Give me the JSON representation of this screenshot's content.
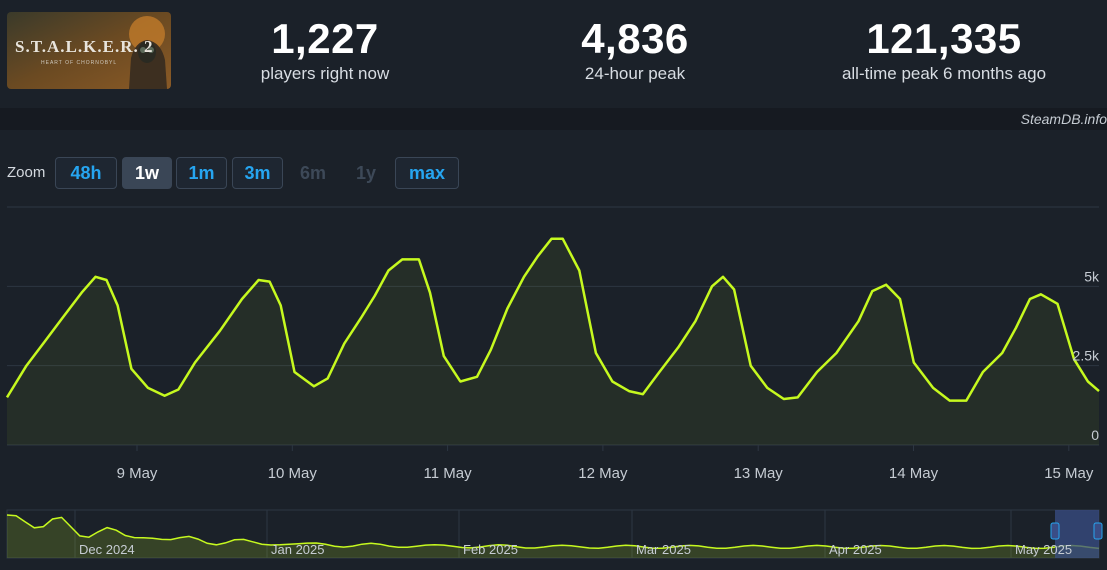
{
  "game": {
    "logo_text": "S.T.A.L.K.E.R. 2",
    "logo_subtext": "HEART OF CHORNOBYL"
  },
  "stats": [
    {
      "value": "1,227",
      "label": "players right now"
    },
    {
      "value": "4,836",
      "label": "24-hour peak"
    },
    {
      "value": "121,335",
      "label": "all-time peak 6 months ago"
    }
  ],
  "credit": "SteamDB.info",
  "zoom": {
    "label": "Zoom",
    "buttons": [
      {
        "label": "48h",
        "state": "normal"
      },
      {
        "label": "1w",
        "state": "active"
      },
      {
        "label": "1m",
        "state": "normal"
      },
      {
        "label": "3m",
        "state": "normal"
      },
      {
        "label": "6m",
        "state": "disabled"
      },
      {
        "label": "1y",
        "state": "disabled"
      },
      {
        "label": "max",
        "state": "normal"
      }
    ]
  },
  "colors": {
    "line": "#c6f91f",
    "grid": "#2d3642",
    "axis_text": "#c6ccd3",
    "nav_selection": "#3a4d86"
  },
  "chart_data": {
    "type": "line",
    "title": "",
    "xlabel": "",
    "ylabel": "",
    "xlim": [
      "May 8, 07:00",
      "May 15, 06:00"
    ],
    "ylim": [
      0,
      7500
    ],
    "y_ticks": [
      0,
      2500,
      5000
    ],
    "y_tick_labels": [
      "0",
      "2.5k",
      "5k"
    ],
    "x_ticks": [
      {
        "x": 1,
        "label": "9 May"
      },
      {
        "x": 2,
        "label": "10 May"
      },
      {
        "x": 3,
        "label": "11 May"
      },
      {
        "x": 4,
        "label": "12 May"
      },
      {
        "x": 5,
        "label": "13 May"
      },
      {
        "x": 6,
        "label": "14 May"
      },
      {
        "x": 7,
        "label": "15 May"
      }
    ],
    "grid": true,
    "legend": "none",
    "series": [
      {
        "name": "",
        "x_unit": "days since 8 May 00:00",
        "points": [
          [
            0.3,
            1500
          ],
          [
            0.37,
            2500
          ],
          [
            0.44,
            3300
          ],
          [
            0.5,
            4000
          ],
          [
            0.57,
            4800
          ],
          [
            0.62,
            5300
          ],
          [
            0.66,
            5200
          ],
          [
            0.7,
            4400
          ],
          [
            0.75,
            2400
          ],
          [
            0.81,
            1800
          ],
          [
            0.87,
            1550
          ],
          [
            0.92,
            1750
          ],
          [
            0.98,
            2600
          ],
          [
            1.07,
            3600
          ],
          [
            1.15,
            4600
          ],
          [
            1.21,
            5200
          ],
          [
            1.25,
            5150
          ],
          [
            1.29,
            4400
          ],
          [
            1.34,
            2300
          ],
          [
            1.41,
            1850
          ],
          [
            1.46,
            2100
          ],
          [
            1.52,
            3200
          ],
          [
            1.58,
            4000
          ],
          [
            1.63,
            4700
          ],
          [
            1.68,
            5500
          ],
          [
            1.73,
            5850
          ],
          [
            1.79,
            5850
          ],
          [
            1.83,
            4800
          ],
          [
            1.88,
            2800
          ],
          [
            1.94,
            2000
          ],
          [
            2.0,
            2150
          ],
          [
            2.05,
            3000
          ],
          [
            2.11,
            4300
          ],
          [
            2.17,
            5300
          ],
          [
            2.22,
            5950
          ],
          [
            2.27,
            6500
          ],
          [
            2.31,
            6500
          ],
          [
            2.37,
            5500
          ],
          [
            2.43,
            2900
          ],
          [
            2.49,
            2000
          ],
          [
            2.55,
            1700
          ],
          [
            2.6,
            1600
          ],
          [
            2.66,
            2300
          ],
          [
            2.73,
            3100
          ],
          [
            2.79,
            3900
          ],
          [
            2.85,
            5000
          ],
          [
            2.89,
            5300
          ],
          [
            2.93,
            4900
          ],
          [
            2.99,
            2500
          ],
          [
            3.05,
            1800
          ],
          [
            3.11,
            1450
          ],
          [
            3.16,
            1500
          ],
          [
            3.23,
            2300
          ],
          [
            3.3,
            2900
          ],
          [
            3.38,
            3900
          ],
          [
            3.43,
            4850
          ],
          [
            3.48,
            5050
          ],
          [
            3.53,
            4600
          ],
          [
            3.58,
            2600
          ],
          [
            3.65,
            1800
          ],
          [
            3.71,
            1400
          ],
          [
            3.77,
            1400
          ],
          [
            3.83,
            2300
          ],
          [
            3.9,
            2900
          ],
          [
            3.95,
            3700
          ],
          [
            4.0,
            4600
          ],
          [
            4.04,
            4750
          ],
          [
            4.1,
            4450
          ],
          [
            4.16,
            2700
          ],
          [
            4.21,
            2000
          ],
          [
            4.25,
            1700
          ]
        ]
      }
    ]
  },
  "navigator": {
    "labels": [
      "Dec 2024",
      "Jan 2025",
      "Feb 2025",
      "Mar 2025",
      "Apr 2025",
      "May 2025"
    ]
  }
}
